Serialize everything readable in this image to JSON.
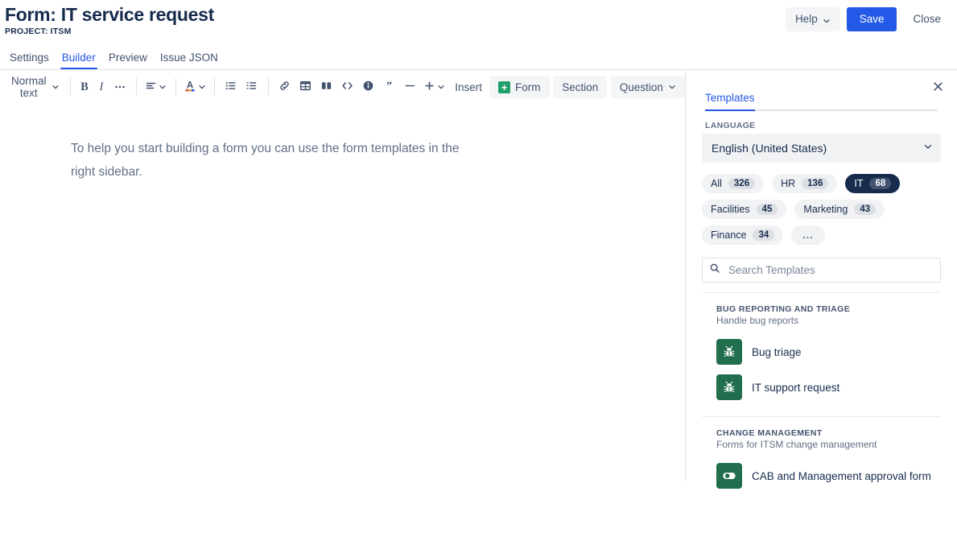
{
  "header": {
    "title": "Form: IT service request",
    "project_label": "PROJECT: ITSM",
    "help_label": "Help",
    "save_label": "Save",
    "close_label": "Close",
    "accent_color": "#2458E6"
  },
  "tabs": [
    {
      "label": "Settings",
      "active": false
    },
    {
      "label": "Builder",
      "active": true
    },
    {
      "label": "Preview",
      "active": false
    },
    {
      "label": "Issue JSON",
      "active": false
    }
  ],
  "toolbar": {
    "text_style": "Normal text",
    "bold": "B",
    "italic": "I",
    "more_formatting": "more-formatting-icon",
    "align": "align-left-icon",
    "text_color": "text-color-icon",
    "bullet_list": "bullet-list-icon",
    "numbered_list": "numbered-list-icon",
    "link": "link-icon",
    "table": "table-icon",
    "layout": "layout-columns-icon",
    "code": "code-icon",
    "info_panel": "info-panel-icon",
    "quote": "quote-icon",
    "divider": "horizontal-rule-icon",
    "plus": "plus-icon",
    "insert_label": "Insert",
    "form_label": "Form",
    "section_label": "Section",
    "question_label": "Question"
  },
  "editor": {
    "paragraph": "To help you start building a form you can use the form templates in the right sidebar."
  },
  "sidebar": {
    "close_icon": "close-icon",
    "tab_label": "Templates",
    "language_label": "LANGUAGE",
    "language_value": "English (United States)",
    "chips": [
      {
        "label": "All",
        "count": "326",
        "selected": false
      },
      {
        "label": "HR",
        "count": "136",
        "selected": false
      },
      {
        "label": "IT",
        "count": "68",
        "selected": true
      },
      {
        "label": "Facilities",
        "count": "45",
        "selected": false
      },
      {
        "label": "Marketing",
        "count": "43",
        "selected": false
      },
      {
        "label": "Finance",
        "count": "34",
        "selected": false
      }
    ],
    "more_chip": "...",
    "search_placeholder": "Search Templates",
    "search_value": "",
    "groups": [
      {
        "title": "BUG REPORTING AND TRIAGE",
        "subtitle": "Handle bug reports",
        "items": [
          {
            "name": "Bug triage",
            "icon": "bug-icon",
            "icon_color": "#216E4E"
          },
          {
            "name": "IT support request",
            "icon": "bug-icon",
            "icon_color": "#216E4E"
          }
        ]
      },
      {
        "title": "CHANGE MANAGEMENT",
        "subtitle": "Forms for ITSM change management",
        "items": [
          {
            "name": "CAB and Management approval form",
            "icon": "toggle-icon",
            "icon_color": "#216E4E"
          }
        ]
      }
    ]
  }
}
